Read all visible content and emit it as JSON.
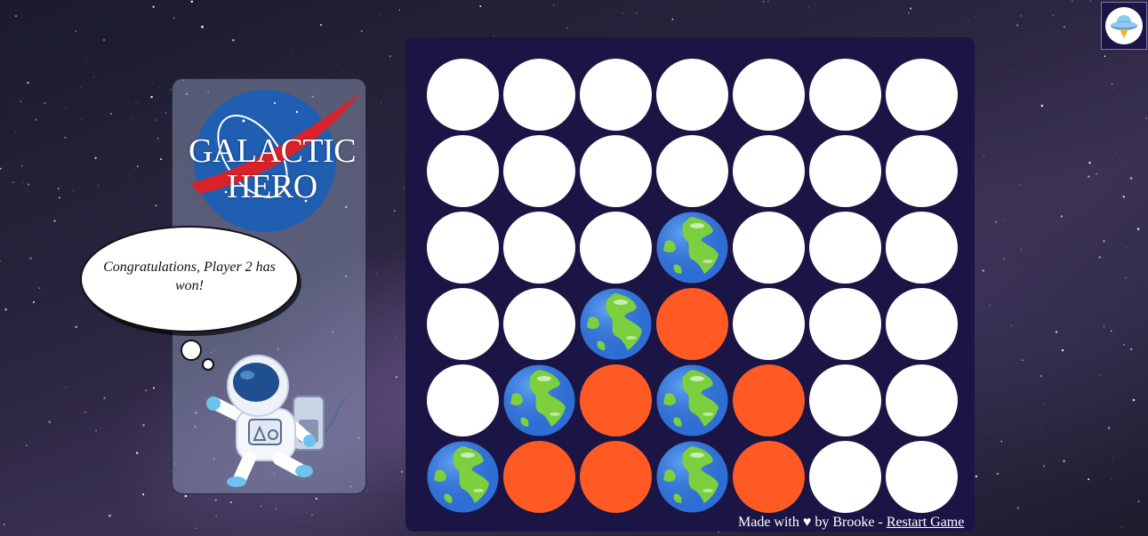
{
  "app": {
    "logo_line1": "GALACTIC",
    "logo_line2": "HERO"
  },
  "message": {
    "text": "Congratulations, Player 2 has won!"
  },
  "footer": {
    "made_with": "Made with",
    "heart": "♥",
    "by": "by Brooke -",
    "restart_label": "Restart Game"
  },
  "colors": {
    "board": "#1a1545",
    "player1": "#ff5a24",
    "empty": "#ffffff",
    "panel": "rgba(150,165,195,0.45)"
  },
  "icons": {
    "player2_piece": "earth-globe-icon",
    "top_right_button": "ufo-icon",
    "astronaut": "astronaut-illustration",
    "logo": "nasa-style-meatball-logo"
  },
  "board": {
    "rows": 6,
    "cols": 7,
    "cells": [
      [
        "empty",
        "empty",
        "empty",
        "empty",
        "empty",
        "empty",
        "empty"
      ],
      [
        "empty",
        "empty",
        "empty",
        "empty",
        "empty",
        "empty",
        "empty"
      ],
      [
        "empty",
        "empty",
        "empty",
        "p2",
        "empty",
        "empty",
        "empty"
      ],
      [
        "empty",
        "empty",
        "p2",
        "p1",
        "empty",
        "empty",
        "empty"
      ],
      [
        "empty",
        "p2",
        "p1",
        "p2",
        "p1",
        "empty",
        "empty"
      ],
      [
        "p2",
        "p1",
        "p1",
        "p2",
        "p1",
        "empty",
        "empty"
      ]
    ]
  }
}
